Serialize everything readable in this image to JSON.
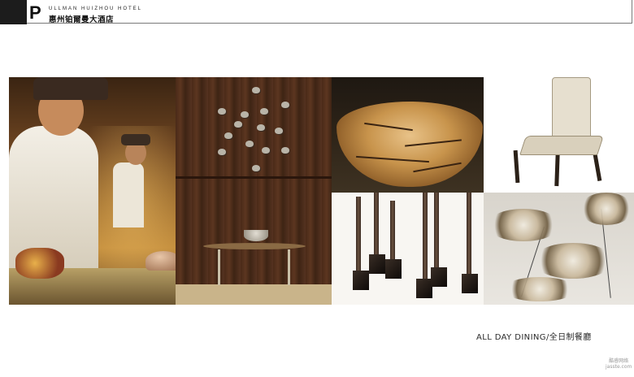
{
  "header": {
    "logo_mark": "P",
    "brand_en": "ULLMAN HUIZHOU HOTEL",
    "brand_zh": "惠州铂爾曼大酒店"
  },
  "photos": [
    {
      "subject": "chefs-at-teppanyaki-counter"
    },
    {
      "subject": "wood-wall-with-bird-sculptures-and-console"
    },
    {
      "subject": "cross-cut-log-table"
    },
    {
      "subject": "upholstered-dining-chair"
    },
    {
      "subject": "sculptural-poles-on-blocks"
    },
    {
      "subject": "metal-lily-pad-sculptures"
    }
  ],
  "caption": {
    "text": "ALL DAY DINING/全日制餐廳"
  },
  "watermark": {
    "line1": "酷睿网络",
    "line2": "jasste.com"
  }
}
